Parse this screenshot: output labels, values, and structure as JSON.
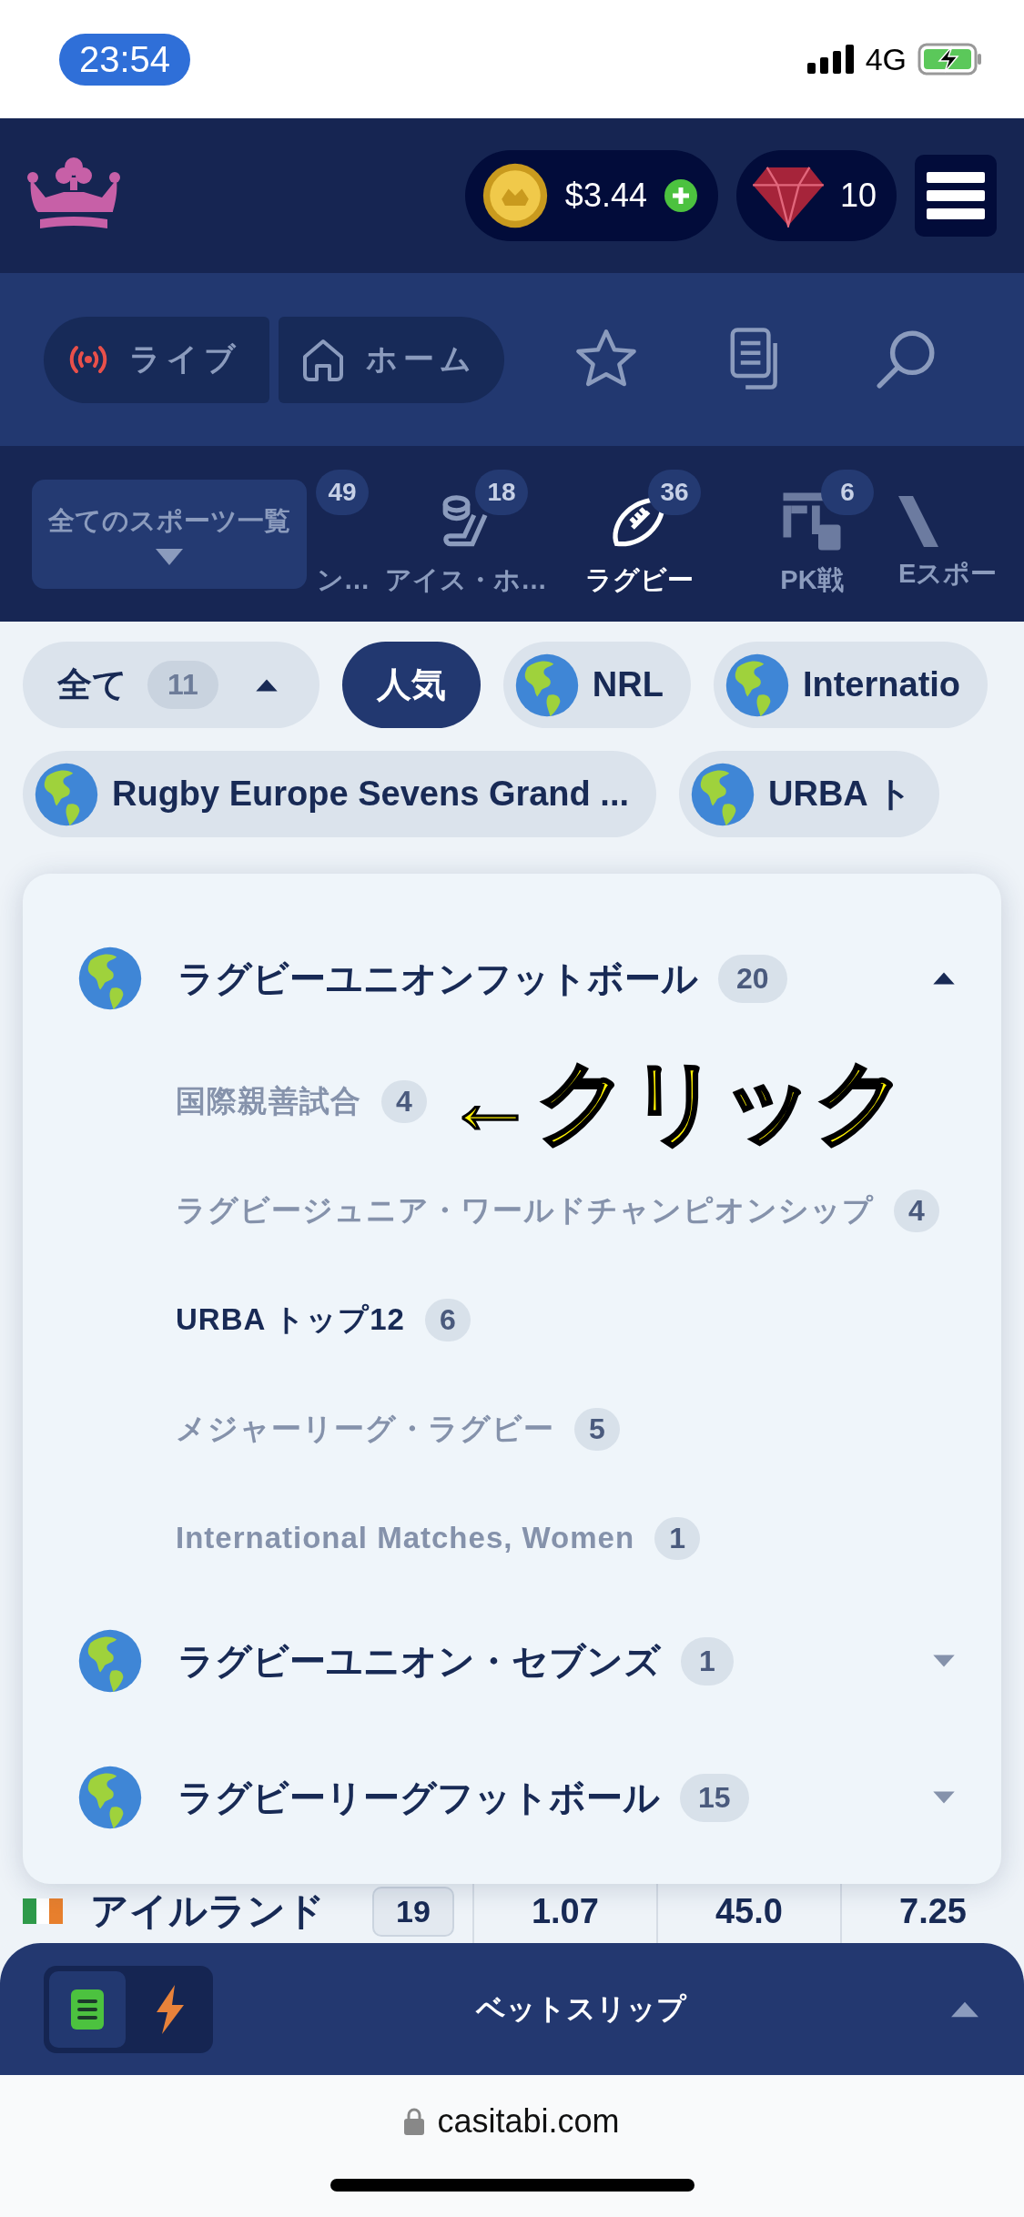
{
  "status_bar": {
    "time": "23:54",
    "network": "4G"
  },
  "header": {
    "balance": "$3.44",
    "gems": "10"
  },
  "nav": {
    "tabs": [
      {
        "kind": "live",
        "label": "ライブ"
      },
      {
        "kind": "home",
        "label": "ホーム"
      }
    ]
  },
  "sports": {
    "all_button": "全てのスポーツ一覧",
    "items": [
      {
        "kind": "hidden",
        "label": "ン…",
        "count": "49",
        "selected": false
      },
      {
        "kind": "hockey",
        "label": "アイス・ホ…",
        "count": "18",
        "selected": false
      },
      {
        "kind": "rugby",
        "label": "ラグビー",
        "count": "36",
        "selected": true
      },
      {
        "kind": "fifa",
        "label": "PK戦",
        "count": "6",
        "selected": false
      },
      {
        "kind": "esports",
        "label": "Eスポー",
        "selected": false
      }
    ]
  },
  "filters": {
    "top_row": [
      {
        "kind": "all",
        "label": "全て",
        "count": "11",
        "expanded": true,
        "selected": false
      },
      {
        "kind": "plain",
        "label": "人気",
        "selected": true
      },
      {
        "kind": "globe",
        "label": "NRL",
        "selected": false
      },
      {
        "kind": "globe",
        "label": "Internatio",
        "selected": false
      }
    ],
    "bottom_row": [
      {
        "kind": "globe",
        "label": "Rugby Europe Sevens Grand ...",
        "selected": false
      },
      {
        "kind": "globe",
        "label": "URBA ト",
        "selected": false
      }
    ]
  },
  "dropdown": {
    "groups": [
      {
        "name": "ラグビーユニオンフットボール",
        "count": "20",
        "expanded": true,
        "children": [
          {
            "name": "国際親善試合",
            "count": "4",
            "selected": false
          },
          {
            "name": "ラグビージュニア・ワールドチャンピオンシップ",
            "count": "4",
            "selected": false
          },
          {
            "name": "URBA トップ12",
            "count": "6",
            "selected": true
          },
          {
            "name": "メジャーリーグ・ラグビー",
            "count": "5",
            "selected": false
          },
          {
            "name": "International Matches, Women",
            "count": "1",
            "selected": false
          }
        ]
      },
      {
        "name": "ラグビーユニオン・セブンズ",
        "count": "1",
        "expanded": false
      },
      {
        "name": "ラグビーリーグフットボール",
        "count": "15",
        "expanded": false
      }
    ]
  },
  "annotation": "←クリック",
  "background_row": {
    "name": "アイルランド",
    "count": "19",
    "odds": [
      "1.07",
      "45.0",
      "7.25"
    ]
  },
  "bet_slip": {
    "title": "ベットスリップ"
  },
  "browser": {
    "url": "casitabi.com"
  }
}
